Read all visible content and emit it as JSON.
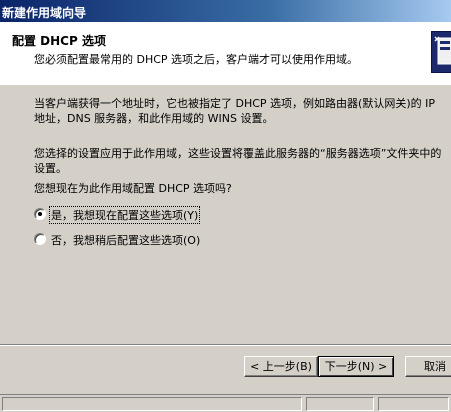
{
  "window": {
    "title": "新建作用域向导"
  },
  "header": {
    "title": "配置 DHCP 选项",
    "subtitle": "您必须配置最常用的 DHCP 选项之后，客户端才可以使用作用域。",
    "icon": "wizard-icon"
  },
  "content": {
    "intro": "当客户端获得一个地址时，它也被指定了 DHCP 选项，例如路由器(默认网关)的 IP 地址，DNS 服务器，和此作用域的 WINS 设置。",
    "scope_note": "您选择的设置应用于此作用域，这些设置将覆盖此服务器的“服务器选项”文件夹中的设置。",
    "question": "您想现在为此作用域配置 DHCP 选项吗?"
  },
  "options": [
    {
      "label": "是，我想现在配置这些选项(Y)",
      "selected": true
    },
    {
      "label": "否，我想稍后配置这些选项(O)",
      "selected": false
    }
  ],
  "buttons": {
    "back": "< 上一步(B)",
    "next": "下一步(N) >",
    "cancel": "取消"
  },
  "colors": {
    "title_bar_start": "#0a246a",
    "title_bar_end": "#a6caf0",
    "dialog_bg": "#d4d0c8"
  }
}
